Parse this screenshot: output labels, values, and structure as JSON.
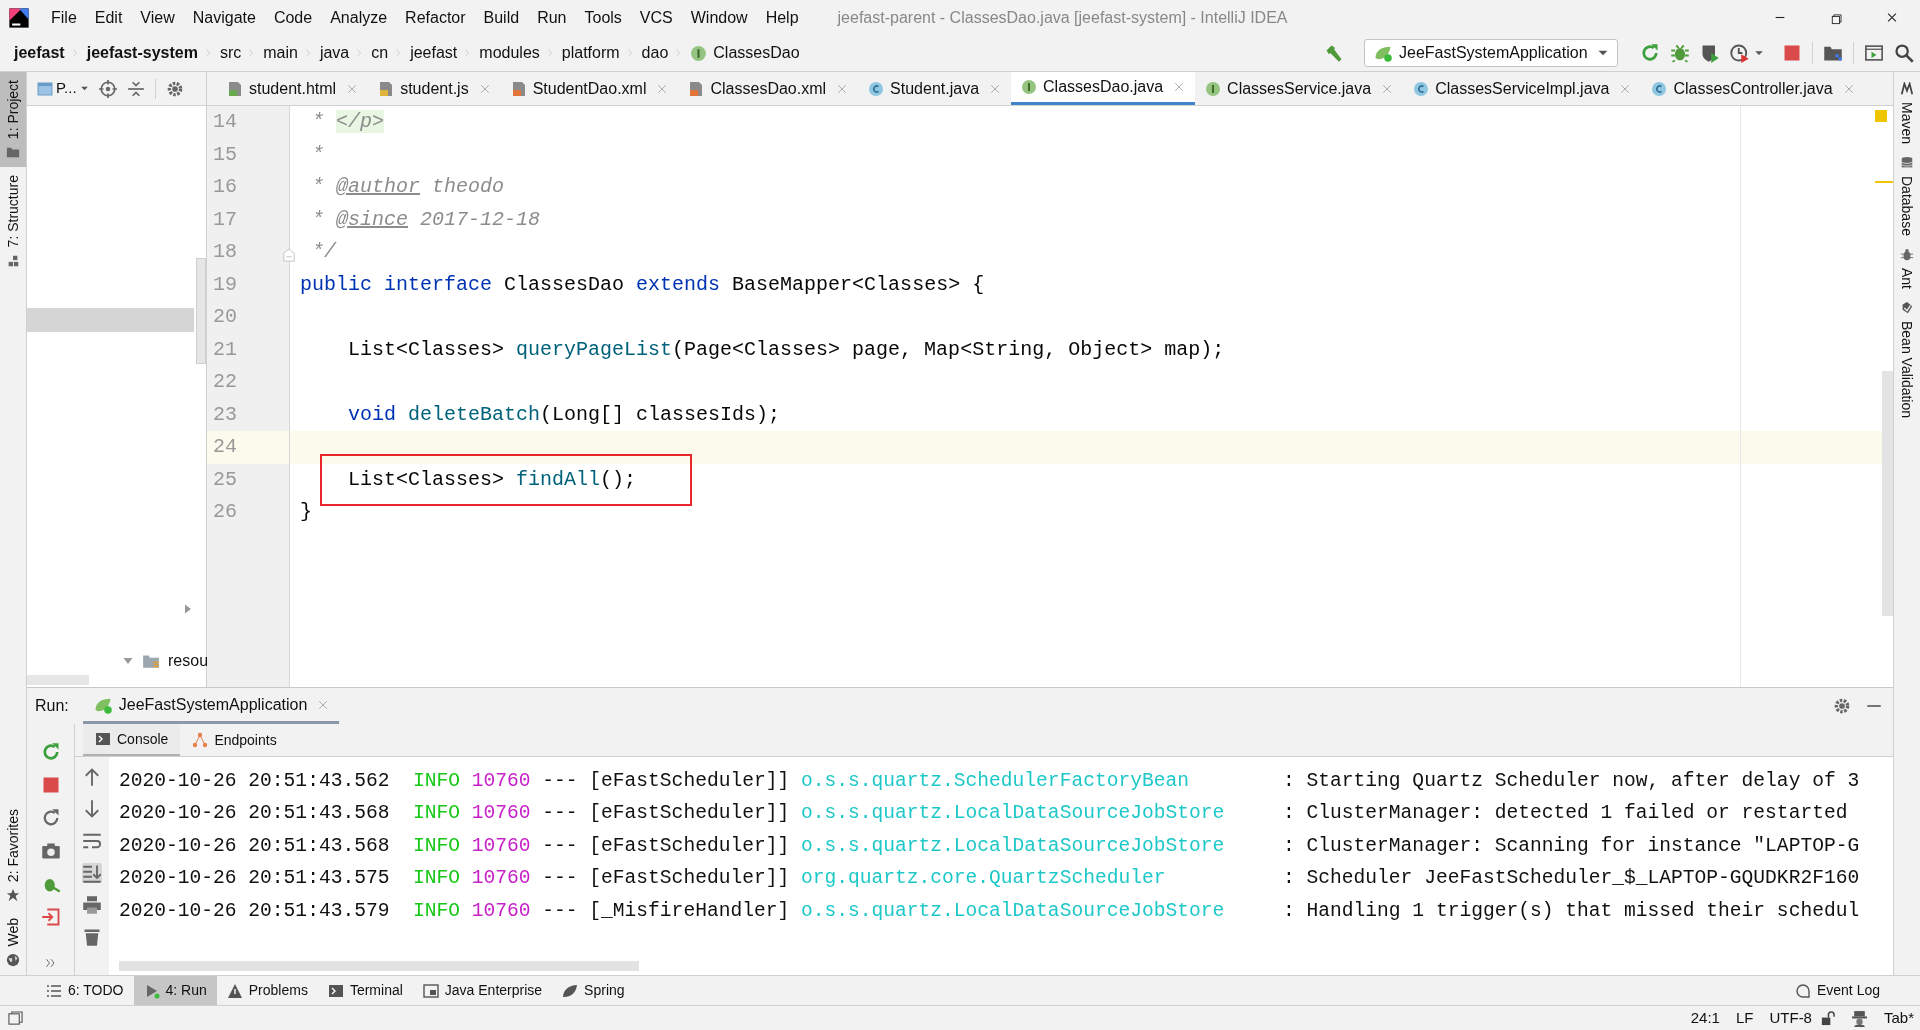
{
  "window": {
    "title": "jeefast-parent - ClassesDao.java [jeefast-system] - IntelliJ IDEA"
  },
  "menu": [
    "File",
    "Edit",
    "View",
    "Navigate",
    "Code",
    "Analyze",
    "Refactor",
    "Build",
    "Run",
    "Tools",
    "VCS",
    "Window",
    "Help"
  ],
  "breadcrumbs": [
    {
      "label": "jeefast",
      "kind": "module"
    },
    {
      "label": "jeefast-system",
      "kind": "module"
    },
    {
      "label": "src",
      "kind": "dir"
    },
    {
      "label": "main",
      "kind": "dir"
    },
    {
      "label": "java",
      "kind": "dir"
    },
    {
      "label": "cn",
      "kind": "dir"
    },
    {
      "label": "jeefast",
      "kind": "dir"
    },
    {
      "label": "modules",
      "kind": "dir"
    },
    {
      "label": "platform",
      "kind": "dir"
    },
    {
      "label": "dao",
      "kind": "dir"
    },
    {
      "label": "ClassesDao",
      "kind": "interface"
    }
  ],
  "run_config": {
    "label": "JeeFastSystemApplication"
  },
  "left_strip": [
    {
      "label": "1: Project",
      "selected": true
    },
    {
      "label": "7: Structure",
      "selected": false
    }
  ],
  "left_strip_bottom": [
    {
      "label": "2: Favorites",
      "selected": false
    },
    {
      "label": "Web",
      "selected": false
    }
  ],
  "right_strip": [
    "Maven",
    "Database",
    "Ant",
    "Bean Validation"
  ],
  "project_panel": {
    "title": "P...",
    "tree": [
      {
        "label": "resou",
        "expanded": true
      }
    ]
  },
  "editor_tabs": [
    {
      "label": "student.html",
      "kind": "html",
      "selected": false
    },
    {
      "label": "student.js",
      "kind": "js",
      "selected": false
    },
    {
      "label": "StudentDao.xml",
      "kind": "xml",
      "selected": false
    },
    {
      "label": "ClassesDao.xml",
      "kind": "xml",
      "selected": false
    },
    {
      "label": "Student.java",
      "kind": "class",
      "selected": false
    },
    {
      "label": "ClassesDao.java",
      "kind": "interface",
      "selected": true
    },
    {
      "label": "ClassesService.java",
      "kind": "interface",
      "selected": false
    },
    {
      "label": "ClassesServiceImpl.java",
      "kind": "class",
      "selected": false
    },
    {
      "label": "ClassesController.java",
      "kind": "class",
      "selected": false
    }
  ],
  "code": [
    {
      "number": "14",
      "current": false,
      "boxed": false,
      "tokens": [
        {
          "text": " * ",
          "kind": "comment"
        },
        {
          "text": "</p>",
          "kind": "html_tag"
        }
      ]
    },
    {
      "number": "15",
      "current": false,
      "boxed": false,
      "tokens": [
        {
          "text": " *",
          "kind": "comment"
        }
      ]
    },
    {
      "number": "16",
      "current": false,
      "boxed": false,
      "tokens": [
        {
          "text": " * ",
          "kind": "comment"
        },
        {
          "text": "@author",
          "kind": "doc_tag"
        },
        {
          "text": " theodo",
          "kind": "comment"
        }
      ]
    },
    {
      "number": "17",
      "current": false,
      "boxed": false,
      "tokens": [
        {
          "text": " * ",
          "kind": "comment"
        },
        {
          "text": "@since",
          "kind": "doc_tag"
        },
        {
          "text": " 2017-12-18",
          "kind": "comment"
        }
      ]
    },
    {
      "number": "18",
      "current": false,
      "boxed": false,
      "tokens": [
        {
          "text": " */",
          "kind": "comment"
        }
      ]
    },
    {
      "number": "19",
      "current": false,
      "boxed": false,
      "tokens": [
        {
          "text": "public",
          "kind": "keyword"
        },
        {
          "text": " interface",
          "kind": "keyword"
        },
        {
          "text": " ClassesDao ",
          "kind": "plain"
        },
        {
          "text": "extends",
          "kind": "keyword"
        },
        {
          "text": " BaseMapper<Classes> {",
          "kind": "plain"
        }
      ]
    },
    {
      "number": "20",
      "current": false
    },
    {
      "number": "21",
      "current": false,
      "boxed": false,
      "tokens": [
        {
          "text": "    List<Classes> ",
          "kind": "plain"
        },
        {
          "text": "queryPageList",
          "kind": "method"
        },
        {
          "text": "(Page<Classes> page, Map<String, Object> map);",
          "kind": "plain"
        }
      ]
    },
    {
      "number": "22",
      "current": false
    },
    {
      "number": "23",
      "current": false,
      "boxed": false,
      "tokens": [
        {
          "text": "    void",
          "kind": "keyword"
        },
        {
          "text": " deleteBatch",
          "kind": "method"
        },
        {
          "text": "(Long[] classesIds);",
          "kind": "plain"
        }
      ]
    },
    {
      "number": "24",
      "current": true
    },
    {
      "number": "25",
      "current": false,
      "boxed": true,
      "tokens": [
        {
          "text": "    List<Classes> ",
          "kind": "plain"
        },
        {
          "text": "findAll",
          "kind": "method"
        },
        {
          "text": "();",
          "kind": "plain"
        }
      ]
    },
    {
      "number": "26",
      "current": false,
      "boxed": false,
      "tokens": [
        {
          "text": "}",
          "kind": "plain"
        }
      ]
    }
  ],
  "run_panel": {
    "label": "Run:",
    "tab": "JeeFastSystemApplication",
    "subtabs": [
      {
        "label": "Console",
        "kind": "console",
        "selected": true
      },
      {
        "label": "Endpoints",
        "kind": "endpoints",
        "selected": false
      }
    ],
    "console": [
      {
        "timestamp": "2020-10-26 20:51:43.562",
        "level": "INFO",
        "pid": "10760",
        "separator": "---",
        "thread": "[eFastScheduler]]",
        "logger": "o.s.s.quartz.SchedulerFactoryBean",
        "message": ": Starting Quartz Scheduler now, after delay of 3"
      },
      {
        "timestamp": "2020-10-26 20:51:43.568",
        "level": "INFO",
        "pid": "10760",
        "separator": "---",
        "thread": "[eFastScheduler]]",
        "logger": "o.s.s.quartz.LocalDataSourceJobStore",
        "message": ": ClusterManager: detected 1 failed or restarted"
      },
      {
        "timestamp": "2020-10-26 20:51:43.568",
        "level": "INFO",
        "pid": "10760",
        "separator": "---",
        "thread": "[eFastScheduler]]",
        "logger": "o.s.s.quartz.LocalDataSourceJobStore",
        "message": ": ClusterManager: Scanning for instance \"LAPTOP-G"
      },
      {
        "timestamp": "2020-10-26 20:51:43.575",
        "level": "INFO",
        "pid": "10760",
        "separator": "---",
        "thread": "[eFastScheduler]]",
        "logger": "org.quartz.core.QuartzScheduler",
        "message": ": Scheduler JeeFastScheduler_$_LAPTOP-GQUDKR2F160"
      },
      {
        "timestamp": "2020-10-26 20:51:43.579",
        "level": "INFO",
        "pid": "10760",
        "separator": "---",
        "thread": "[_MisfireHandler]",
        "logger": "o.s.s.quartz.LocalDataSourceJobStore",
        "message": ": Handling 1 trigger(s) that missed their schedul"
      }
    ]
  },
  "tool_tabs": [
    {
      "label": "6: TODO",
      "kind": "todo",
      "selected": false
    },
    {
      "label": "4: Run",
      "kind": "run",
      "selected": true
    },
    {
      "label": "Problems",
      "kind": "problems",
      "selected": false
    },
    {
      "label": "Terminal",
      "kind": "terminal",
      "selected": false
    },
    {
      "label": "Java Enterprise",
      "kind": "enterprise",
      "selected": false
    },
    {
      "label": "Spring",
      "kind": "spring",
      "selected": false
    }
  ],
  "event_log": "Event Log",
  "status": {
    "position": "24:1",
    "line_separator": "LF",
    "encoding": "UTF-8",
    "indent": "Tab*"
  }
}
